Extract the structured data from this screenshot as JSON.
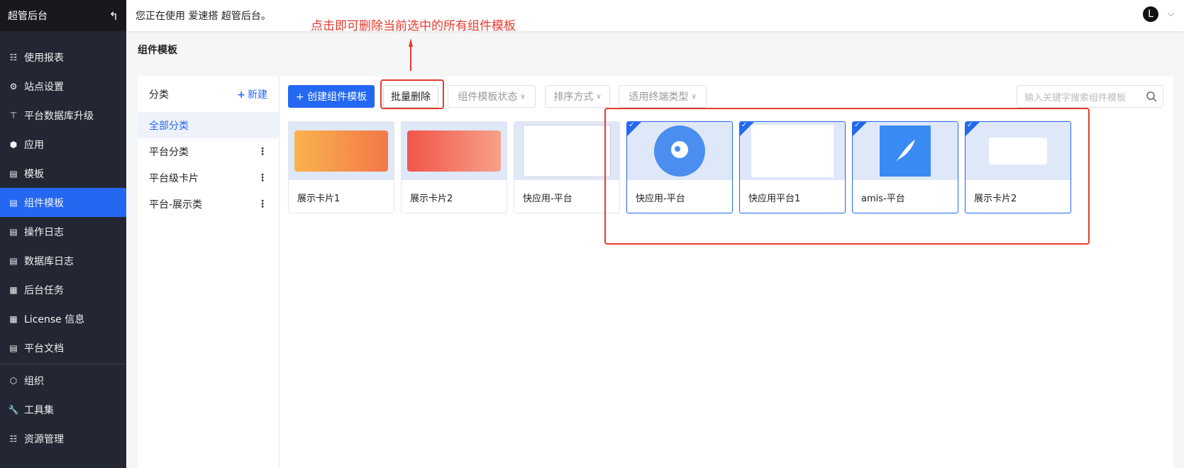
{
  "sidebar": {
    "brand": "超管后台",
    "items": [
      {
        "label": "使用报表",
        "icon": "grid-icon"
      },
      {
        "label": "站点设置",
        "icon": "gear-icon"
      },
      {
        "label": "平台数据库升级",
        "icon": "upload-icon"
      },
      {
        "label": "应用",
        "icon": "cube-icon"
      },
      {
        "label": "模板",
        "icon": "template-icon"
      },
      {
        "label": "组件模板",
        "icon": "template-icon",
        "active": true
      },
      {
        "label": "操作日志",
        "icon": "log-icon"
      },
      {
        "label": "数据库日志",
        "icon": "log-icon"
      },
      {
        "label": "后台任务",
        "icon": "task-icon"
      },
      {
        "label": "License 信息",
        "icon": "license-icon"
      },
      {
        "label": "平台文档",
        "icon": "doc-icon"
      },
      {
        "label": "组织",
        "icon": "org-icon"
      },
      {
        "label": "工具集",
        "icon": "wrench-icon"
      },
      {
        "label": "资源管理",
        "icon": "grid-icon"
      }
    ]
  },
  "header": {
    "welcome": "您正在使用 爱速搭 超管后台。",
    "avatar_letter": "L"
  },
  "annotation": "点击即可删除当前选中的所有组件模板",
  "page_title": "组件模板",
  "category": {
    "title": "分类",
    "new_label": "新建",
    "items": [
      {
        "label": "全部分类",
        "active": true
      },
      {
        "label": "平台分类"
      },
      {
        "label": "平台级卡片"
      },
      {
        "label": "平台-展示类"
      }
    ]
  },
  "toolbar": {
    "create_label": "+ 创建组件模板",
    "batch_delete_label": "批量删除",
    "status_filter": "组件模板状态",
    "sort_filter": "排序方式",
    "terminal_filter": "适用终端类型",
    "search_placeholder": "输入关键字搜索组件模板"
  },
  "cards": [
    {
      "label": "展示卡片1",
      "selected": false
    },
    {
      "label": "展示卡片2",
      "selected": false
    },
    {
      "label": "快应用-平台",
      "selected": false
    },
    {
      "label": "快应用-平台",
      "selected": true
    },
    {
      "label": "快应用平台1",
      "selected": true
    },
    {
      "label": "amis-平台",
      "selected": true
    },
    {
      "label": "展示卡片2",
      "selected": true
    }
  ],
  "colors": {
    "primary": "#2468f2",
    "annotation": "#e53a2f",
    "sidebar": "#232733"
  }
}
